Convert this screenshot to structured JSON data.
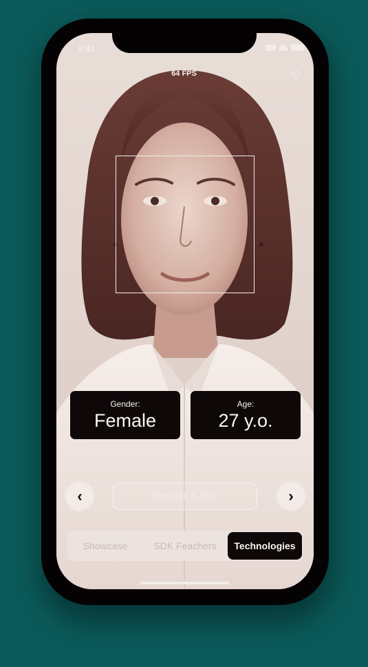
{
  "status_bar": {
    "time": "9:41"
  },
  "camera": {
    "fps_label": "64 FPS",
    "switch_icon": "camera-switch-icon"
  },
  "results": {
    "gender_label": "Gender:",
    "gender_value": "Female",
    "age_label": "Age:",
    "age_value": "27 y.o."
  },
  "mode_selector": {
    "current": "Gender & Age",
    "prev_icon": "chevron-left-icon",
    "next_icon": "chevron-right-icon"
  },
  "tabs": [
    {
      "label": "Showcase",
      "selected": false
    },
    {
      "label": "SDK Feachers",
      "selected": false
    },
    {
      "label": "Technologies",
      "selected": true
    }
  ],
  "colors": {
    "background": "#0b5a5a",
    "phone_frame": "#050203",
    "card": "#0e0809",
    "card_text": "#fbf6f4"
  }
}
